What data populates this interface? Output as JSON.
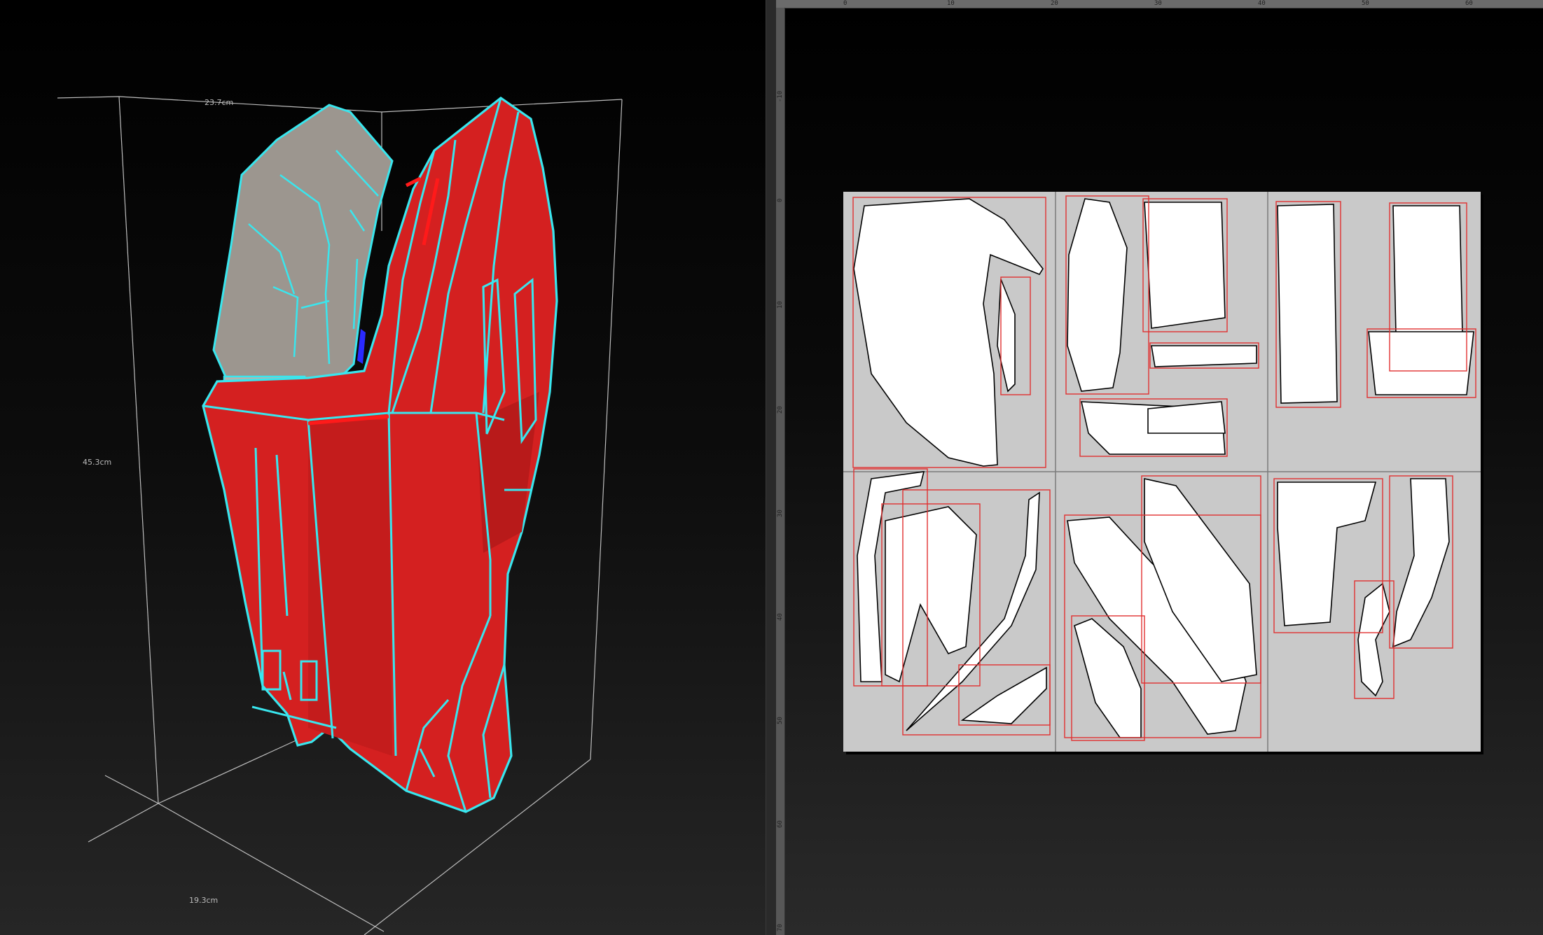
{
  "viewport_3d": {
    "dimensions": {
      "width": "23.7cm",
      "height": "45.3cm",
      "depth": "19.3cm"
    },
    "colors": {
      "model_face": "#d42020",
      "edge_highlight": "#39e6ee",
      "interior_face": "#9c968f",
      "box_lines": "#bdbdbd"
    }
  },
  "viewport_2d": {
    "ruler_h_labels": [
      "0",
      "10",
      "20",
      "30",
      "40",
      "50",
      "60"
    ],
    "ruler_v_labels": [
      "-10",
      "0",
      "10",
      "20",
      "30",
      "40",
      "50",
      "60",
      "70"
    ],
    "sheet_pages": 6,
    "colors": {
      "sheet_bg": "#c9c9c9",
      "part_fill": "#ffffff",
      "bbox_stroke": "#e03030",
      "page_divider": "#7a7a7a"
    }
  }
}
